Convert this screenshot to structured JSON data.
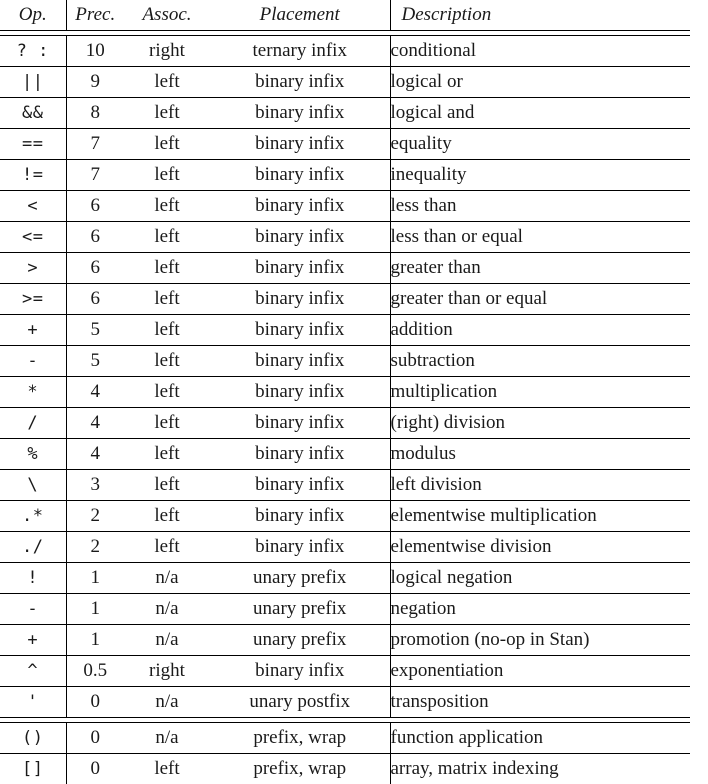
{
  "table": {
    "headers": {
      "op": "Op.",
      "prec": "Prec.",
      "assoc": "Assoc.",
      "placement": "Placement",
      "description": "Description"
    },
    "groups": [
      {
        "rows": [
          {
            "op": "? :",
            "prec": "10",
            "assoc": "right",
            "placement": "ternary infix",
            "description": "conditional"
          }
        ]
      },
      {
        "rows": [
          {
            "op": "||",
            "prec": "9",
            "assoc": "left",
            "placement": "binary infix",
            "description": "logical or"
          }
        ]
      },
      {
        "rows": [
          {
            "op": "&&",
            "prec": "8",
            "assoc": "left",
            "placement": "binary infix",
            "description": "logical and"
          }
        ]
      },
      {
        "rows": [
          {
            "op": "==",
            "prec": "7",
            "assoc": "left",
            "placement": "binary infix",
            "description": "equality"
          },
          {
            "op": "!=",
            "prec": "7",
            "assoc": "left",
            "placement": "binary infix",
            "description": "inequality"
          }
        ]
      },
      {
        "rows": [
          {
            "op": "<",
            "prec": "6",
            "assoc": "left",
            "placement": "binary infix",
            "description": "less than"
          },
          {
            "op": "<=",
            "prec": "6",
            "assoc": "left",
            "placement": "binary infix",
            "description": "less than or equal"
          },
          {
            "op": ">",
            "prec": "6",
            "assoc": "left",
            "placement": "binary infix",
            "description": "greater than"
          },
          {
            "op": ">=",
            "prec": "6",
            "assoc": "left",
            "placement": "binary infix",
            "description": "greater than or equal"
          }
        ]
      },
      {
        "rows": [
          {
            "op": "+",
            "prec": "5",
            "assoc": "left",
            "placement": "binary infix",
            "description": "addition"
          },
          {
            "op": "-",
            "prec": "5",
            "assoc": "left",
            "placement": "binary infix",
            "description": "subtraction"
          }
        ]
      },
      {
        "rows": [
          {
            "op": "*",
            "prec": "4",
            "assoc": "left",
            "placement": "binary infix",
            "description": "multiplication"
          },
          {
            "op": "/",
            "prec": "4",
            "assoc": "left",
            "placement": "binary infix",
            "description": "(right) division"
          },
          {
            "op": "%",
            "prec": "4",
            "assoc": "left",
            "placement": "binary infix",
            "description": "modulus"
          }
        ]
      },
      {
        "rows": [
          {
            "op": "\\",
            "prec": "3",
            "assoc": "left",
            "placement": "binary infix",
            "description": "left division"
          }
        ]
      },
      {
        "rows": [
          {
            "op": ".*",
            "prec": "2",
            "assoc": "left",
            "placement": "binary infix",
            "description": "elementwise multiplication"
          },
          {
            "op": "./",
            "prec": "2",
            "assoc": "left",
            "placement": "binary infix",
            "description": "elementwise division"
          }
        ]
      },
      {
        "rows": [
          {
            "op": "!",
            "prec": "1",
            "assoc": "n/a",
            "placement": "unary prefix",
            "description": "logical negation"
          },
          {
            "op": "-",
            "prec": "1",
            "assoc": "n/a",
            "placement": "unary prefix",
            "description": "negation"
          },
          {
            "op": "+",
            "prec": "1",
            "assoc": "n/a",
            "placement": "unary prefix",
            "description": "promotion (no-op in Stan)"
          }
        ]
      },
      {
        "rows": [
          {
            "op": "^",
            "prec": "0.5",
            "assoc": "right",
            "placement": "binary infix",
            "description": "exponentiation"
          }
        ]
      },
      {
        "rows": [
          {
            "op": "'",
            "prec": "0",
            "assoc": "n/a",
            "placement": "unary postfix",
            "description": "transposition"
          }
        ]
      }
    ],
    "footer_groups": [
      {
        "rows": [
          {
            "op": "()",
            "prec": "0",
            "assoc": "n/a",
            "placement": "prefix, wrap",
            "description": "function application"
          },
          {
            "op": "[]",
            "prec": "0",
            "assoc": "left",
            "placement": "prefix, wrap",
            "description": "array, matrix indexing"
          }
        ]
      }
    ]
  }
}
